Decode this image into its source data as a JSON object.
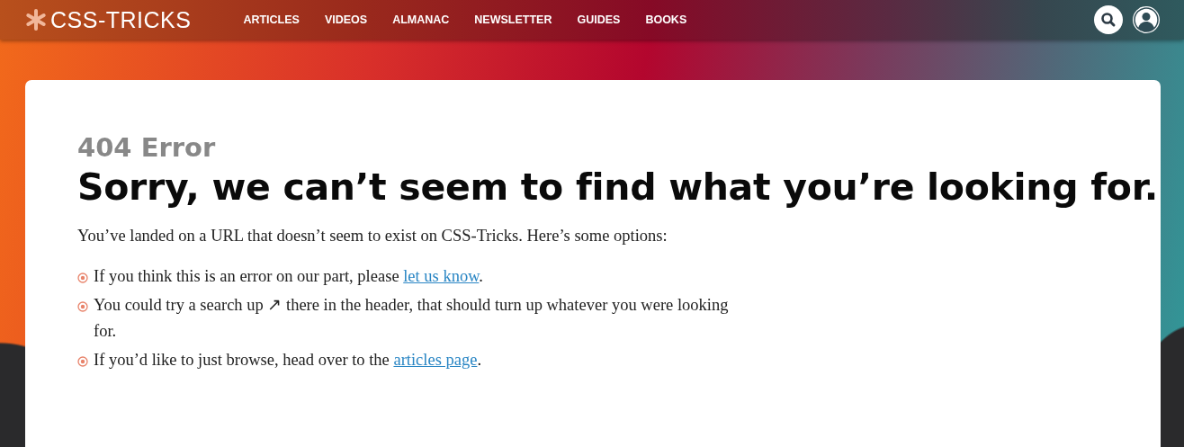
{
  "header": {
    "logo": "CSS-TRICKS",
    "nav": [
      "ARTICLES",
      "VIDEOS",
      "ALMANAC",
      "NEWSLETTER",
      "GUIDES",
      "BOOKS"
    ]
  },
  "content": {
    "eyebrow": "404 Error",
    "title": "Sorry, we can’t seem to find what you’re looking for.",
    "intro": "You’ve landed on a URL that doesn’t seem to exist on CSS-Tricks. Here’s some options:",
    "options": [
      {
        "text": "If you think this is an error on our part, please ",
        "link": "let us know",
        "after": "."
      },
      {
        "text": "You could try a search up ↗ there in the header, that should turn up whatever you were looking for."
      },
      {
        "text": "If you’d like to just browse, head over to the ",
        "link": "articles page",
        "after": "."
      }
    ]
  }
}
